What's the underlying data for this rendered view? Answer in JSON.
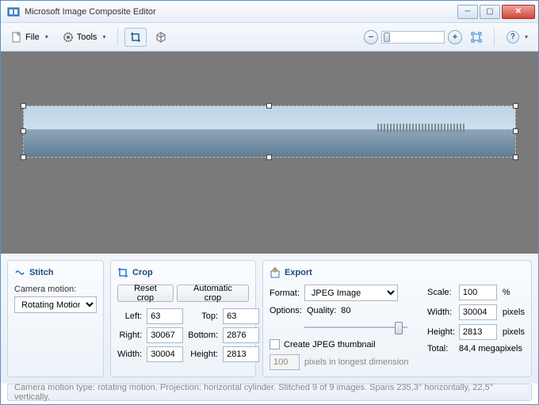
{
  "window": {
    "title": "Microsoft Image Composite Editor"
  },
  "toolbar": {
    "file": "File",
    "tools": "Tools"
  },
  "panels": {
    "stitch": {
      "title": "Stitch",
      "camera_motion_label": "Camera motion:",
      "camera_motion_value": "Rotating Motion"
    },
    "crop": {
      "title": "Crop",
      "reset": "Reset crop",
      "auto": "Automatic crop",
      "left_label": "Left:",
      "left": "63",
      "top_label": "Top:",
      "top": "63",
      "right_label": "Right:",
      "right": "30067",
      "bottom_label": "Bottom:",
      "bottom": "2876",
      "width_label": "Width:",
      "width": "30004",
      "height_label": "Height:",
      "height": "2813"
    },
    "export": {
      "title": "Export",
      "format_label": "Format:",
      "format_value": "JPEG Image",
      "options_label": "Options:",
      "quality_label": "Quality:",
      "quality_value": "80",
      "create_thumb": "Create JPEG thumbnail",
      "thumb_value": "100",
      "thumb_suffix": "pixels in longest dimension",
      "scale_label": "Scale:",
      "scale": "100",
      "scale_unit": "%",
      "width_label": "Width:",
      "width": "30004",
      "px": "pixels",
      "height_label": "Height:",
      "height": "2813",
      "total_label": "Total:",
      "total": "84,4 megapixels"
    }
  },
  "status": "Camera motion type: rotating motion. Projection: horizontal cylinder. Stitched 9 of 9 images. Spans 235,3° horizontally, 22,5° vertically."
}
